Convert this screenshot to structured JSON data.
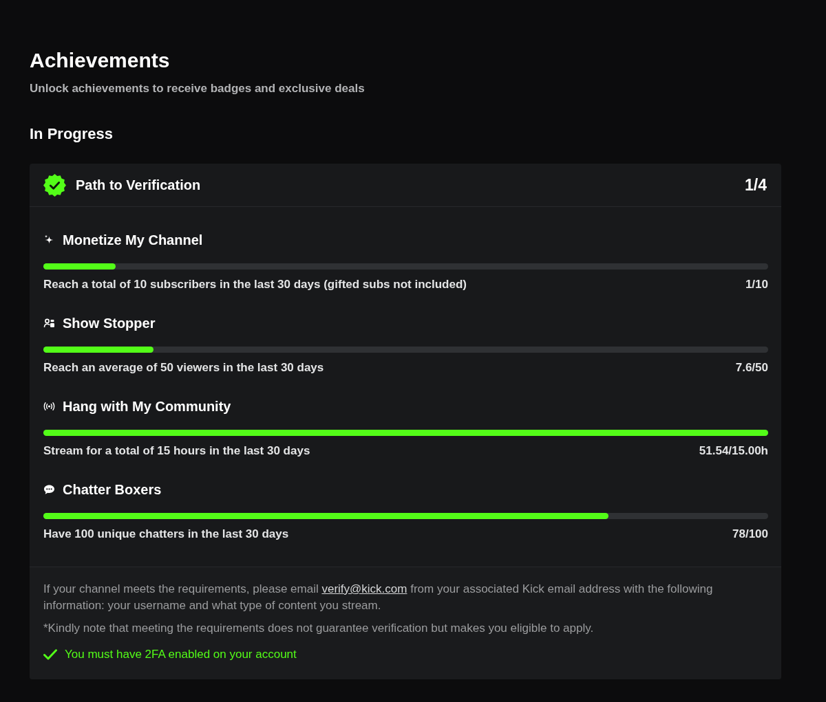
{
  "page": {
    "title": "Achievements",
    "subtitle": "Unlock achievements to receive badges and exclusive deals"
  },
  "section": {
    "title": "In Progress"
  },
  "card": {
    "title": "Path to Verification",
    "count": "1/4",
    "achievements": [
      {
        "kind": "sparkle",
        "title": "Monetize My Channel",
        "level": 0.1,
        "description": "Reach a total of 10 subscribers in the last 30 days (gifted subs not included)",
        "reading": "1/10"
      },
      {
        "kind": "viewers",
        "title": "Show Stopper",
        "level": 0.152,
        "description": "Reach an average of 50 viewers in the last 30 days",
        "reading": "7.6/50"
      },
      {
        "kind": "broadcast",
        "title": "Hang with My Community",
        "level": 1,
        "description": "Stream for a total of 15 hours in the last 30 days",
        "reading": "51.54/15.00h"
      },
      {
        "kind": "chat",
        "title": "Chatter Boxers",
        "level": 0.78,
        "description": "Have 100 unique chatters in the last 30 days",
        "reading": "78/100"
      }
    ],
    "footer": {
      "info": {
        "before": "If your channel meets the requirements, please email ",
        "link": "verify@kick.com",
        "after": " from your associated Kick email address with the following information: your username and what type of content you stream."
      },
      "note": "*Kindly note that meeting the requirements does not guarantee verification but makes you eligible to apply.",
      "requirement": {
        "text": "You must have 2FA enabled on your account",
        "met": true
      }
    }
  }
}
